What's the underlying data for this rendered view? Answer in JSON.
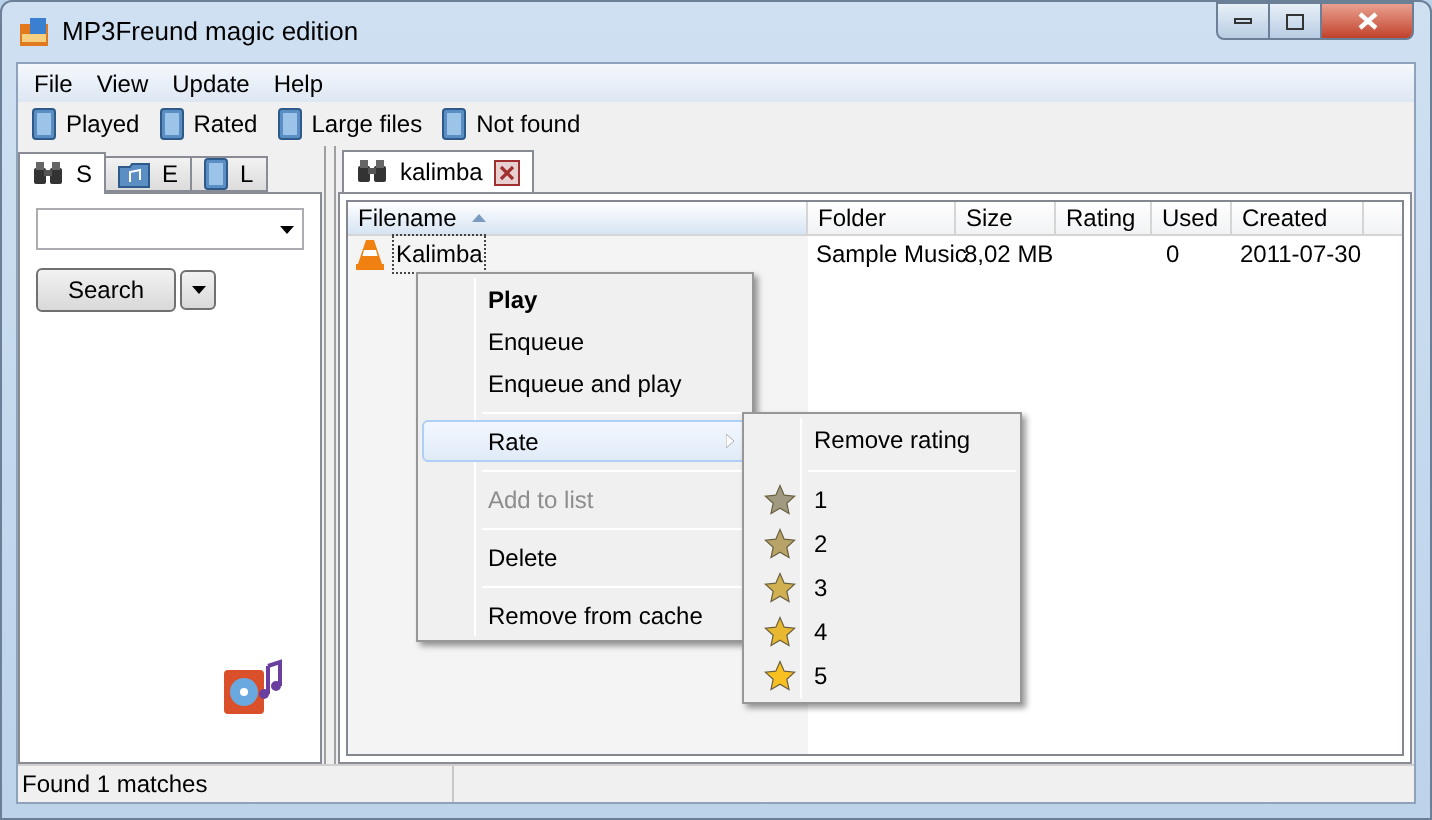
{
  "window": {
    "title": "MP3Freund magic edition"
  },
  "menu": [
    "File",
    "View",
    "Update",
    "Help"
  ],
  "toolbar": [
    "Played",
    "Rated",
    "Large files",
    "Not found"
  ],
  "left_tabs": [
    {
      "label": "S",
      "selected": true
    },
    {
      "label": "E",
      "selected": false
    },
    {
      "label": "L",
      "selected": false
    }
  ],
  "search_button": "Search",
  "result_tab": {
    "label": "kalimba",
    "selected": true
  },
  "table": {
    "columns": [
      {
        "label": "Filename",
        "sorted": true
      },
      {
        "label": "Folder",
        "sorted": false
      },
      {
        "label": "Size",
        "sorted": false
      },
      {
        "label": "Rating",
        "sorted": false
      },
      {
        "label": "Used",
        "sorted": false
      },
      {
        "label": "Created",
        "sorted": false
      }
    ],
    "rows": [
      {
        "cells": [
          "Kalimba",
          "Sample Music",
          "8,02 MB",
          "",
          "0",
          "2011-07-30"
        ],
        "selected": true
      }
    ]
  },
  "context_menu": [
    {
      "kind": "item",
      "label": "Play",
      "default": true,
      "disabled": false,
      "selected": false,
      "submenu": false
    },
    {
      "kind": "item",
      "label": "Enqueue",
      "default": false,
      "disabled": false,
      "selected": false,
      "submenu": false
    },
    {
      "kind": "item",
      "label": "Enqueue and play",
      "default": false,
      "disabled": false,
      "selected": false,
      "submenu": false
    },
    {
      "kind": "separator"
    },
    {
      "kind": "item",
      "label": "Rate",
      "default": false,
      "disabled": false,
      "selected": true,
      "submenu": true
    },
    {
      "kind": "separator"
    },
    {
      "kind": "item",
      "label": "Add to list",
      "default": false,
      "disabled": true,
      "selected": false,
      "submenu": false
    },
    {
      "kind": "separator"
    },
    {
      "kind": "item",
      "label": "Delete",
      "default": false,
      "disabled": false,
      "selected": false,
      "submenu": false
    },
    {
      "kind": "separator"
    },
    {
      "kind": "item",
      "label": "Remove from cache",
      "default": false,
      "disabled": false,
      "selected": false,
      "submenu": false
    }
  ],
  "rate_submenu": [
    {
      "kind": "item",
      "label": "Remove rating"
    },
    {
      "kind": "separator"
    },
    {
      "kind": "star",
      "label": "1",
      "color": "#a09a80"
    },
    {
      "kind": "star",
      "label": "2",
      "color": "#b8a468"
    },
    {
      "kind": "star",
      "label": "3",
      "color": "#d0b050"
    },
    {
      "kind": "star",
      "label": "4",
      "color": "#e8b830"
    },
    {
      "kind": "star",
      "label": "5",
      "color": "#f8c020"
    }
  ],
  "status_bar": "Found 1 matches"
}
